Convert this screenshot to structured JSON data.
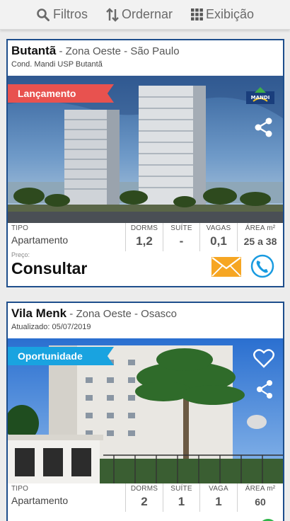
{
  "toolbar": {
    "filters_label": "Filtros",
    "sort_label": "Ordernar",
    "view_label": "Exibição"
  },
  "listings": [
    {
      "city": "Butantã",
      "location": " - Zona Oeste - São Paulo",
      "subtitle": "Cond. Mandi USP Butantã",
      "badge": "Lançamento",
      "badge_color": "#e8524f",
      "specs": {
        "type_label": "TIPO",
        "type_value": "Apartamento",
        "dorms_label": "DORMS",
        "dorms_value": "1,2",
        "suite_label": "SUÍTE",
        "suite_value": "-",
        "vagas_label": "VAGAS",
        "vagas_value": "0,1",
        "area_label": "ÁREA m²",
        "area_value": "25 a 38"
      },
      "price_label": "Preço:",
      "price_value": "Consultar"
    },
    {
      "city": "Vila Menk",
      "location": " - Zona Oeste - Osasco",
      "subtitle": "Atualizado: 05/07/2019",
      "badge": "Oportunidade",
      "badge_color": "#19a3e0",
      "specs": {
        "type_label": "TIPO",
        "type_value": "Apartamento",
        "dorms_label": "DORMS",
        "dorms_value": "2",
        "suite_label": "SUÍTE",
        "suite_value": "1",
        "vagas_label": "VAGA",
        "vagas_value": "1",
        "area_label": "ÁREA m²",
        "area_value": "60"
      }
    }
  ],
  "colors": {
    "card_border": "#1e4e8c",
    "mail": "#f6a623",
    "phone": "#1a9be0"
  }
}
